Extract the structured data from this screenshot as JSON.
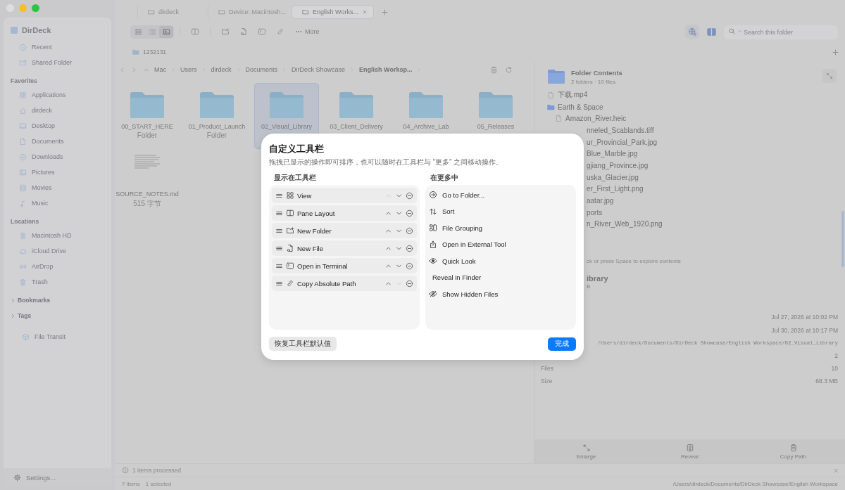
{
  "sidebar": {
    "app_name": "DirDeck",
    "items": [
      {
        "label": "Recent"
      },
      {
        "label": "Shared Folder"
      }
    ],
    "sections": [
      {
        "title": "Favorites",
        "items": [
          {
            "label": "Applications"
          },
          {
            "label": "dirdeck"
          },
          {
            "label": "Desktop"
          },
          {
            "label": "Documents"
          },
          {
            "label": "Downloads"
          },
          {
            "label": "Pictures"
          },
          {
            "label": "Movies"
          },
          {
            "label": "Music"
          }
        ]
      },
      {
        "title": "Locations",
        "items": [
          {
            "label": "Macintosh HD"
          },
          {
            "label": "iCloud Drive"
          },
          {
            "label": "AirDrop"
          },
          {
            "label": "Trash"
          }
        ]
      }
    ],
    "groups": [
      {
        "label": "Bookmarks",
        "expanded": false
      },
      {
        "label": "Tags",
        "expanded": false
      }
    ],
    "extra": {
      "label": "File Transit"
    },
    "settings": "Settings..."
  },
  "tabs": [
    {
      "label": "dirdeck",
      "selected": false
    },
    {
      "label": "Device: Macintosh...",
      "selected": false
    },
    {
      "label": "English Works...",
      "selected": true
    }
  ],
  "toolbar": {
    "view_modes": [
      {
        "selected": false
      },
      {
        "selected": false
      },
      {
        "selected": true
      }
    ],
    "more": "More",
    "search": {
      "placeholder": "Search this folder"
    }
  },
  "bookmarks": [
    {
      "label": "1232131"
    }
  ],
  "breadcrumb": [
    "Mac",
    "Users",
    "dirdeck",
    "Documents",
    "DirDeck Showcase",
    "English Worksp..."
  ],
  "files": [
    {
      "name": "00_START_HERE",
      "sub": "Folder",
      "kind": "folder",
      "selected": false
    },
    {
      "name": "01_Product_Launch",
      "sub": "Folder",
      "kind": "folder",
      "selected": false
    },
    {
      "name": "02_Visual_Library",
      "kind": "folder",
      "selected": true
    },
    {
      "name": "03_Client_Delivery",
      "kind": "folder",
      "selected": false
    },
    {
      "name": "04_Archive_Lab",
      "kind": "folder",
      "selected": false
    },
    {
      "name": "05_Releases",
      "kind": "folder",
      "selected": false
    },
    {
      "name": "SOURCE_NOTES.md",
      "sub": "515 字节",
      "kind": "document",
      "selected": false
    }
  ],
  "details": {
    "title": "Folder Contents",
    "subtitle": "2 folders · 10 files",
    "tree": [
      {
        "name": "下载.mp4",
        "kind": "file"
      },
      {
        "name": "Earth & Space",
        "kind": "folder",
        "children": [
          {
            "name": "Amazon_River.heic",
            "kind": "file"
          },
          {
            "name": "nneled_Scablands.tiff"
          },
          {
            "name": "ur_Provincial_Park.jpg"
          },
          {
            "name": "Blue_Marble.jpg"
          },
          {
            "name": "gjiang_Province.jpg"
          },
          {
            "name": "uska_Glacier.jpg"
          },
          {
            "name": "er_First_Light.png"
          },
          {
            "name": "aatar.jpg"
          },
          {
            "name": "ports"
          },
          {
            "name": "n_River_Web_1920.png"
          }
        ]
      }
    ],
    "hint": "ck or press Space to explore contents",
    "name": "ibrary",
    "name_sub": "B",
    "meta": [
      {
        "kind": "text",
        "value": "Jul 27, 2026 at 10:02 PM"
      },
      {
        "kind": "text",
        "value": "Jul 30, 2026 at 10:17 PM"
      },
      {
        "kind": "path",
        "value": "/Users/dirdeck/Documents/DirDeck Showcase/English Workspace/02_Visual_Library"
      },
      {
        "kind": "text",
        "value": "2"
      },
      {
        "kind": "text",
        "label": "Files",
        "value": "10"
      },
      {
        "kind": "text",
        "label": "Size",
        "value": "68.3 MB"
      }
    ],
    "actions": [
      "Enlarge",
      "Reveal",
      "Copy Path"
    ]
  },
  "status": {
    "message": "1 items processed"
  },
  "footer": {
    "count": "7 items",
    "selection": "1 selected",
    "path": "/Users/dirdeck/Documents/DirDeck Showcase/English Workspace"
  },
  "modal": {
    "title": "自定义工具栏",
    "subtitle": "拖拽已显示的操作即可排序，也可以随时在工具栏与 “更多” 之间移动操作。",
    "shown_title": "显示在工具栏",
    "more_title": "在更多中",
    "shown": [
      {
        "label": "View",
        "can_move_up": false,
        "can_move_down": true
      },
      {
        "label": "Pane Layout",
        "can_move_up": true,
        "can_move_down": true
      },
      {
        "label": "New Folder",
        "can_move_up": true,
        "can_move_down": true
      },
      {
        "label": "New File",
        "can_move_up": true,
        "can_move_down": true
      },
      {
        "label": "Open in Terminal",
        "can_move_up": true,
        "can_move_down": true
      },
      {
        "label": "Copy Absolute Path",
        "can_move_up": true,
        "can_move_down": false
      }
    ],
    "more": [
      {
        "label": "Go to Folder..."
      },
      {
        "label": "Sort"
      },
      {
        "label": "File Grouping"
      },
      {
        "label": "Open in External Tool"
      },
      {
        "label": "Quick Look"
      },
      {
        "label": "Reveal in Finder"
      },
      {
        "label": "Show Hidden Files"
      }
    ],
    "reset": "恢复工具栏默认值",
    "done": "完成"
  }
}
